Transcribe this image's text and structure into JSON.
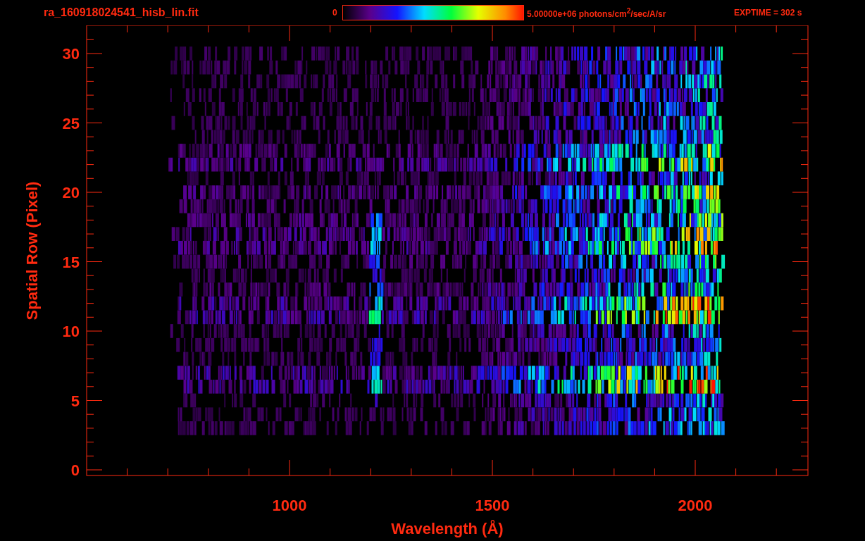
{
  "title": "ra_160918024541_hisb_lin.fit",
  "colorbar": {
    "min_label": "0",
    "max_label": "5.00000e+06 photons/cm$^{2}$/sec/A/sr"
  },
  "exposure": "EXPTIME = 302 s",
  "y_axis": {
    "label": "Spatial Row (Pixel)",
    "ticks": [
      "30",
      "25",
      "20",
      "15",
      "10",
      "5",
      "0"
    ]
  },
  "x_axis": {
    "label": "Wavelength (Å)",
    "ticks": [
      "1000",
      "1500",
      "2000"
    ]
  }
}
